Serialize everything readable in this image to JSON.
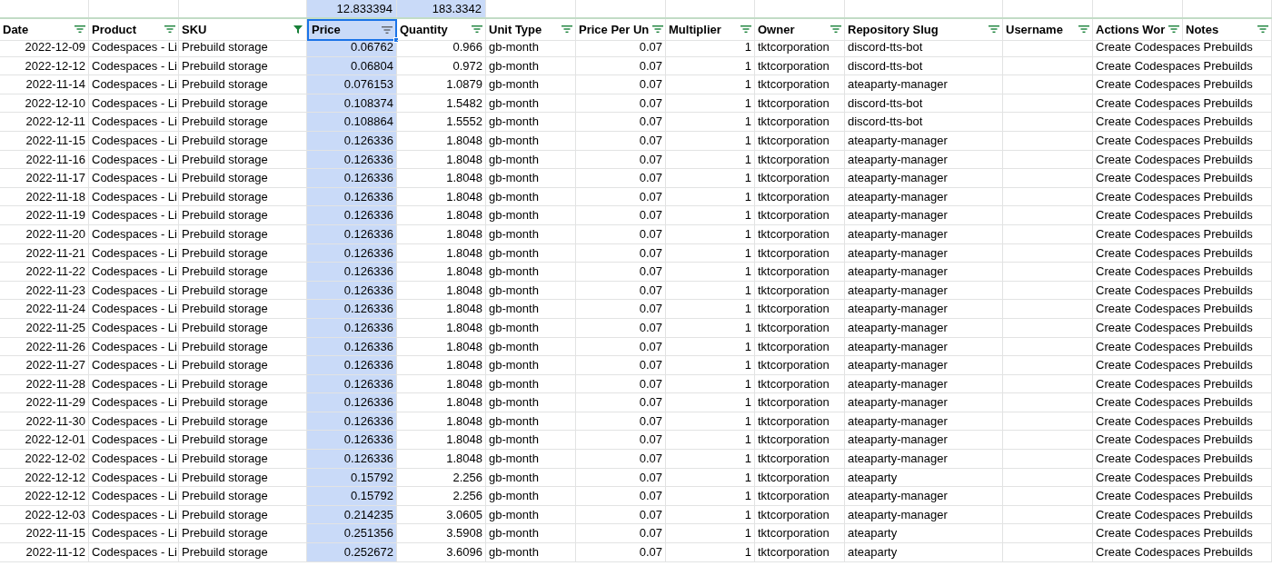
{
  "summary": [
    {
      "value": "12.833394",
      "selected": true
    },
    {
      "value": "183.3342",
      "selected": true
    }
  ],
  "columns": [
    {
      "label": "Date",
      "filtered": false,
      "selected": false
    },
    {
      "label": "Product",
      "filtered": false,
      "selected": false
    },
    {
      "label": "SKU",
      "filtered": true,
      "selected": false
    },
    {
      "label": "Price",
      "filtered": false,
      "selected": true
    },
    {
      "label": "Quantity",
      "filtered": false,
      "selected": false
    },
    {
      "label": "Unit Type",
      "filtered": false,
      "selected": false
    },
    {
      "label": "Price Per Un",
      "filtered": false,
      "selected": false
    },
    {
      "label": "Multiplier",
      "filtered": false,
      "selected": false
    },
    {
      "label": "Owner",
      "filtered": false,
      "selected": false
    },
    {
      "label": "Repository Slug",
      "filtered": false,
      "selected": false
    },
    {
      "label": "Username",
      "filtered": false,
      "selected": false
    },
    {
      "label": "Actions Wor",
      "filtered": false,
      "selected": false
    },
    {
      "label": "Notes",
      "filtered": false,
      "selected": false
    }
  ],
  "rows": [
    {
      "date": "2022-12-09",
      "product": "Codespaces - Li",
      "sku": "Prebuild storage",
      "price": "0.06762",
      "quantity": "0.966",
      "unit_type": "gb-month",
      "price_per_unit": "0.07",
      "multiplier": "1",
      "owner": "tktcorporation",
      "repository_slug": "discord-tts-bot",
      "actions_workflow": "Create Codespaces Prebuilds"
    },
    {
      "date": "2022-12-12",
      "product": "Codespaces - Li",
      "sku": "Prebuild storage",
      "price": "0.06804",
      "quantity": "0.972",
      "unit_type": "gb-month",
      "price_per_unit": "0.07",
      "multiplier": "1",
      "owner": "tktcorporation",
      "repository_slug": "discord-tts-bot",
      "actions_workflow": "Create Codespaces Prebuilds"
    },
    {
      "date": "2022-11-14",
      "product": "Codespaces - Li",
      "sku": "Prebuild storage",
      "price": "0.076153",
      "quantity": "1.0879",
      "unit_type": "gb-month",
      "price_per_unit": "0.07",
      "multiplier": "1",
      "owner": "tktcorporation",
      "repository_slug": "ateaparty-manager",
      "actions_workflow": "Create Codespaces Prebuilds"
    },
    {
      "date": "2022-12-10",
      "product": "Codespaces - Li",
      "sku": "Prebuild storage",
      "price": "0.108374",
      "quantity": "1.5482",
      "unit_type": "gb-month",
      "price_per_unit": "0.07",
      "multiplier": "1",
      "owner": "tktcorporation",
      "repository_slug": "discord-tts-bot",
      "actions_workflow": "Create Codespaces Prebuilds"
    },
    {
      "date": "2022-12-11",
      "product": "Codespaces - Li",
      "sku": "Prebuild storage",
      "price": "0.108864",
      "quantity": "1.5552",
      "unit_type": "gb-month",
      "price_per_unit": "0.07",
      "multiplier": "1",
      "owner": "tktcorporation",
      "repository_slug": "discord-tts-bot",
      "actions_workflow": "Create Codespaces Prebuilds"
    },
    {
      "date": "2022-11-15",
      "product": "Codespaces - Li",
      "sku": "Prebuild storage",
      "price": "0.126336",
      "quantity": "1.8048",
      "unit_type": "gb-month",
      "price_per_unit": "0.07",
      "multiplier": "1",
      "owner": "tktcorporation",
      "repository_slug": "ateaparty-manager",
      "actions_workflow": "Create Codespaces Prebuilds"
    },
    {
      "date": "2022-11-16",
      "product": "Codespaces - Li",
      "sku": "Prebuild storage",
      "price": "0.126336",
      "quantity": "1.8048",
      "unit_type": "gb-month",
      "price_per_unit": "0.07",
      "multiplier": "1",
      "owner": "tktcorporation",
      "repository_slug": "ateaparty-manager",
      "actions_workflow": "Create Codespaces Prebuilds"
    },
    {
      "date": "2022-11-17",
      "product": "Codespaces - Li",
      "sku": "Prebuild storage",
      "price": "0.126336",
      "quantity": "1.8048",
      "unit_type": "gb-month",
      "price_per_unit": "0.07",
      "multiplier": "1",
      "owner": "tktcorporation",
      "repository_slug": "ateaparty-manager",
      "actions_workflow": "Create Codespaces Prebuilds"
    },
    {
      "date": "2022-11-18",
      "product": "Codespaces - Li",
      "sku": "Prebuild storage",
      "price": "0.126336",
      "quantity": "1.8048",
      "unit_type": "gb-month",
      "price_per_unit": "0.07",
      "multiplier": "1",
      "owner": "tktcorporation",
      "repository_slug": "ateaparty-manager",
      "actions_workflow": "Create Codespaces Prebuilds"
    },
    {
      "date": "2022-11-19",
      "product": "Codespaces - Li",
      "sku": "Prebuild storage",
      "price": "0.126336",
      "quantity": "1.8048",
      "unit_type": "gb-month",
      "price_per_unit": "0.07",
      "multiplier": "1",
      "owner": "tktcorporation",
      "repository_slug": "ateaparty-manager",
      "actions_workflow": "Create Codespaces Prebuilds"
    },
    {
      "date": "2022-11-20",
      "product": "Codespaces - Li",
      "sku": "Prebuild storage",
      "price": "0.126336",
      "quantity": "1.8048",
      "unit_type": "gb-month",
      "price_per_unit": "0.07",
      "multiplier": "1",
      "owner": "tktcorporation",
      "repository_slug": "ateaparty-manager",
      "actions_workflow": "Create Codespaces Prebuilds"
    },
    {
      "date": "2022-11-21",
      "product": "Codespaces - Li",
      "sku": "Prebuild storage",
      "price": "0.126336",
      "quantity": "1.8048",
      "unit_type": "gb-month",
      "price_per_unit": "0.07",
      "multiplier": "1",
      "owner": "tktcorporation",
      "repository_slug": "ateaparty-manager",
      "actions_workflow": "Create Codespaces Prebuilds"
    },
    {
      "date": "2022-11-22",
      "product": "Codespaces - Li",
      "sku": "Prebuild storage",
      "price": "0.126336",
      "quantity": "1.8048",
      "unit_type": "gb-month",
      "price_per_unit": "0.07",
      "multiplier": "1",
      "owner": "tktcorporation",
      "repository_slug": "ateaparty-manager",
      "actions_workflow": "Create Codespaces Prebuilds"
    },
    {
      "date": "2022-11-23",
      "product": "Codespaces - Li",
      "sku": "Prebuild storage",
      "price": "0.126336",
      "quantity": "1.8048",
      "unit_type": "gb-month",
      "price_per_unit": "0.07",
      "multiplier": "1",
      "owner": "tktcorporation",
      "repository_slug": "ateaparty-manager",
      "actions_workflow": "Create Codespaces Prebuilds"
    },
    {
      "date": "2022-11-24",
      "product": "Codespaces - Li",
      "sku": "Prebuild storage",
      "price": "0.126336",
      "quantity": "1.8048",
      "unit_type": "gb-month",
      "price_per_unit": "0.07",
      "multiplier": "1",
      "owner": "tktcorporation",
      "repository_slug": "ateaparty-manager",
      "actions_workflow": "Create Codespaces Prebuilds"
    },
    {
      "date": "2022-11-25",
      "product": "Codespaces - Li",
      "sku": "Prebuild storage",
      "price": "0.126336",
      "quantity": "1.8048",
      "unit_type": "gb-month",
      "price_per_unit": "0.07",
      "multiplier": "1",
      "owner": "tktcorporation",
      "repository_slug": "ateaparty-manager",
      "actions_workflow": "Create Codespaces Prebuilds"
    },
    {
      "date": "2022-11-26",
      "product": "Codespaces - Li",
      "sku": "Prebuild storage",
      "price": "0.126336",
      "quantity": "1.8048",
      "unit_type": "gb-month",
      "price_per_unit": "0.07",
      "multiplier": "1",
      "owner": "tktcorporation",
      "repository_slug": "ateaparty-manager",
      "actions_workflow": "Create Codespaces Prebuilds"
    },
    {
      "date": "2022-11-27",
      "product": "Codespaces - Li",
      "sku": "Prebuild storage",
      "price": "0.126336",
      "quantity": "1.8048",
      "unit_type": "gb-month",
      "price_per_unit": "0.07",
      "multiplier": "1",
      "owner": "tktcorporation",
      "repository_slug": "ateaparty-manager",
      "actions_workflow": "Create Codespaces Prebuilds"
    },
    {
      "date": "2022-11-28",
      "product": "Codespaces - Li",
      "sku": "Prebuild storage",
      "price": "0.126336",
      "quantity": "1.8048",
      "unit_type": "gb-month",
      "price_per_unit": "0.07",
      "multiplier": "1",
      "owner": "tktcorporation",
      "repository_slug": "ateaparty-manager",
      "actions_workflow": "Create Codespaces Prebuilds"
    },
    {
      "date": "2022-11-29",
      "product": "Codespaces - Li",
      "sku": "Prebuild storage",
      "price": "0.126336",
      "quantity": "1.8048",
      "unit_type": "gb-month",
      "price_per_unit": "0.07",
      "multiplier": "1",
      "owner": "tktcorporation",
      "repository_slug": "ateaparty-manager",
      "actions_workflow": "Create Codespaces Prebuilds"
    },
    {
      "date": "2022-11-30",
      "product": "Codespaces - Li",
      "sku": "Prebuild storage",
      "price": "0.126336",
      "quantity": "1.8048",
      "unit_type": "gb-month",
      "price_per_unit": "0.07",
      "multiplier": "1",
      "owner": "tktcorporation",
      "repository_slug": "ateaparty-manager",
      "actions_workflow": "Create Codespaces Prebuilds"
    },
    {
      "date": "2022-12-01",
      "product": "Codespaces - Li",
      "sku": "Prebuild storage",
      "price": "0.126336",
      "quantity": "1.8048",
      "unit_type": "gb-month",
      "price_per_unit": "0.07",
      "multiplier": "1",
      "owner": "tktcorporation",
      "repository_slug": "ateaparty-manager",
      "actions_workflow": "Create Codespaces Prebuilds"
    },
    {
      "date": "2022-12-02",
      "product": "Codespaces - Li",
      "sku": "Prebuild storage",
      "price": "0.126336",
      "quantity": "1.8048",
      "unit_type": "gb-month",
      "price_per_unit": "0.07",
      "multiplier": "1",
      "owner": "tktcorporation",
      "repository_slug": "ateaparty-manager",
      "actions_workflow": "Create Codespaces Prebuilds"
    },
    {
      "date": "2022-12-12",
      "product": "Codespaces - Li",
      "sku": "Prebuild storage",
      "price": "0.15792",
      "quantity": "2.256",
      "unit_type": "gb-month",
      "price_per_unit": "0.07",
      "multiplier": "1",
      "owner": "tktcorporation",
      "repository_slug": "ateaparty",
      "actions_workflow": "Create Codespaces Prebuilds"
    },
    {
      "date": "2022-12-12",
      "product": "Codespaces - Li",
      "sku": "Prebuild storage",
      "price": "0.15792",
      "quantity": "2.256",
      "unit_type": "gb-month",
      "price_per_unit": "0.07",
      "multiplier": "1",
      "owner": "tktcorporation",
      "repository_slug": "ateaparty-manager",
      "actions_workflow": "Create Codespaces Prebuilds"
    },
    {
      "date": "2022-12-03",
      "product": "Codespaces - Li",
      "sku": "Prebuild storage",
      "price": "0.214235",
      "quantity": "3.0605",
      "unit_type": "gb-month",
      "price_per_unit": "0.07",
      "multiplier": "1",
      "owner": "tktcorporation",
      "repository_slug": "ateaparty-manager",
      "actions_workflow": "Create Codespaces Prebuilds"
    },
    {
      "date": "2022-11-15",
      "product": "Codespaces - Li",
      "sku": "Prebuild storage",
      "price": "0.251356",
      "quantity": "3.5908",
      "unit_type": "gb-month",
      "price_per_unit": "0.07",
      "multiplier": "1",
      "owner": "tktcorporation",
      "repository_slug": "ateaparty",
      "actions_workflow": "Create Codespaces Prebuilds"
    },
    {
      "date": "2022-11-12",
      "product": "Codespaces - Li",
      "sku": "Prebuild storage",
      "price": "0.252672",
      "quantity": "3.6096",
      "unit_type": "gb-month",
      "price_per_unit": "0.07",
      "multiplier": "1",
      "owner": "tktcorporation",
      "repository_slug": "ateaparty",
      "actions_workflow": "Create Codespaces Prebuilds"
    }
  ]
}
